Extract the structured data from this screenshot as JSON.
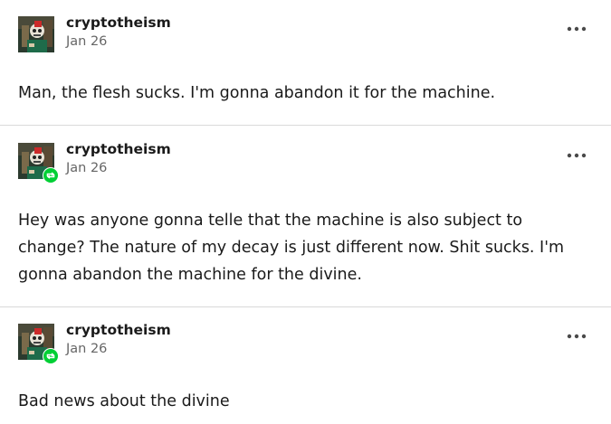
{
  "posts": [
    {
      "username": "cryptotheism",
      "date": "Jan 26",
      "body": "Man, the flesh sucks. I'm gonna abandon it for the machine.",
      "is_reblog": false
    },
    {
      "username": "cryptotheism",
      "date": "Jan 26",
      "body": "Hey was anyone gonna telle that the machine is also subject to change? The nature of my decay is just different now. Shit sucks. I'm gonna abandon the machine for the divine.",
      "is_reblog": true
    },
    {
      "username": "cryptotheism",
      "date": "Jan 26",
      "body": "Bad news about the divine",
      "is_reblog": true
    }
  ],
  "icons": {
    "more": "more-horizontal-icon",
    "reblog": "reblog-icon",
    "avatar": "avatar-image"
  },
  "colors": {
    "reblog_green": "#00cf35",
    "divider": "#d9d9d9",
    "date_gray": "#666666",
    "text": "#1a1a1a"
  }
}
